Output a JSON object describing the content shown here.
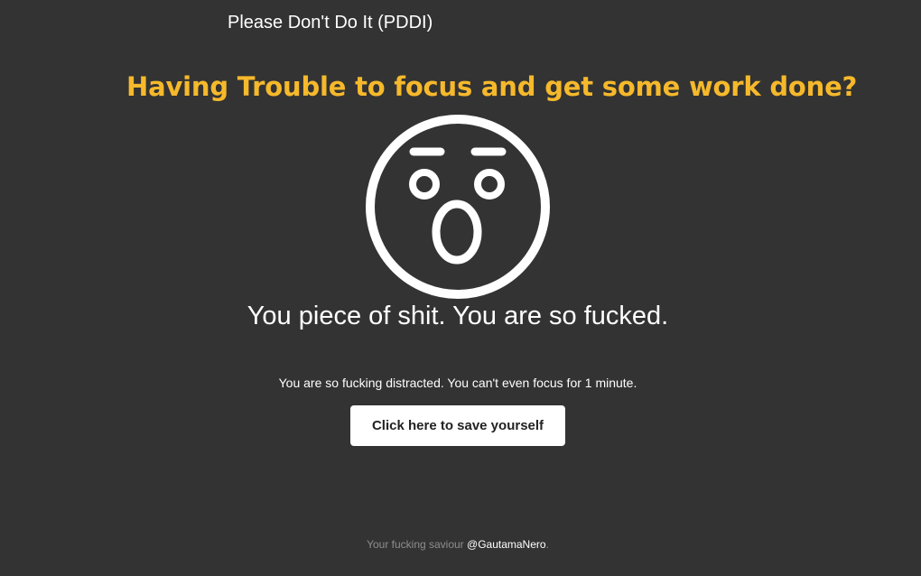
{
  "header": {
    "app_title": "Please Don't Do It (PDDI)"
  },
  "promo": {
    "headline": "Having Trouble to focus and get some work done?"
  },
  "main": {
    "icon": "shocked-face-icon",
    "headline": "You piece of shit. You are so fucked.",
    "subline": "You are so fucking distracted. You can't even focus for 1 minute.",
    "save_button_label": "Click here to save yourself"
  },
  "footer": {
    "prefix": "Your fucking saviour ",
    "handle": "@GautamaNero",
    "suffix": "."
  },
  "colors": {
    "background": "#333333",
    "accent": "#f6b92b",
    "text": "#ffffff",
    "muted": "#8e8e8e"
  }
}
